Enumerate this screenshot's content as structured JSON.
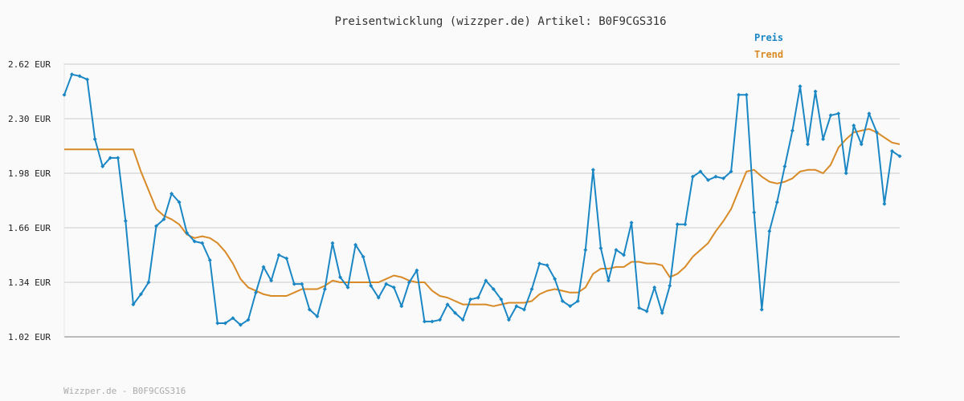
{
  "colors": {
    "price": "#1a87c4",
    "trend": "#d88a26",
    "grid": "#e2e2e2",
    "axis": "#bbbbbb"
  },
  "chart_data": {
    "type": "line",
    "title": "Preisentwicklung (wizzper.de) Artikel: B0F9CGS316",
    "legend": [
      "Preis",
      "Trend"
    ],
    "legend_position": "top-right",
    "grid": true,
    "ylim": [
      1.02,
      2.62
    ],
    "y_ticks": [
      "2.62 EUR",
      "2.30 EUR",
      "1.98 EUR",
      "1.66 EUR",
      "1.34 EUR",
      "1.02 EUR"
    ],
    "series": [
      {
        "name": "Preis",
        "values": [
          2.44,
          2.56,
          2.55,
          2.53,
          2.18,
          2.02,
          2.07,
          2.07,
          1.7,
          1.21,
          1.27,
          1.34,
          1.67,
          1.71,
          1.86,
          1.81,
          1.63,
          1.58,
          1.57,
          1.47,
          1.1,
          1.1,
          1.13,
          1.09,
          1.12,
          1.28,
          1.43,
          1.35,
          1.5,
          1.48,
          1.33,
          1.33,
          1.18,
          1.14,
          1.3,
          1.57,
          1.37,
          1.31,
          1.56,
          1.49,
          1.32,
          1.25,
          1.33,
          1.31,
          1.2,
          1.34,
          1.41,
          1.11,
          1.11,
          1.12,
          1.21,
          1.16,
          1.12,
          1.24,
          1.25,
          1.35,
          1.3,
          1.24,
          1.12,
          1.2,
          1.18,
          1.3,
          1.45,
          1.44,
          1.36,
          1.23,
          1.2,
          1.23,
          1.53,
          2.0,
          1.54,
          1.35,
          1.53,
          1.5,
          1.69,
          1.19,
          1.17,
          1.31,
          1.16,
          1.32,
          1.68,
          1.68,
          1.96,
          1.99,
          1.94,
          1.96,
          1.95,
          1.99,
          2.44,
          2.44,
          1.75,
          1.18,
          1.64,
          1.81,
          2.02,
          2.23,
          2.49,
          2.15,
          2.46,
          2.18,
          2.32,
          2.33,
          1.98,
          2.26,
          2.15,
          2.33,
          2.22,
          1.8,
          2.11,
          2.08
        ]
      },
      {
        "name": "Trend",
        "values": [
          2.12,
          2.12,
          2.12,
          2.12,
          2.12,
          2.12,
          2.12,
          2.12,
          2.12,
          2.12,
          1.99,
          1.88,
          1.77,
          1.73,
          1.71,
          1.68,
          1.62,
          1.6,
          1.61,
          1.6,
          1.57,
          1.52,
          1.45,
          1.36,
          1.31,
          1.29,
          1.27,
          1.26,
          1.26,
          1.26,
          1.28,
          1.3,
          1.3,
          1.3,
          1.32,
          1.35,
          1.34,
          1.34,
          1.34,
          1.34,
          1.34,
          1.34,
          1.36,
          1.38,
          1.37,
          1.35,
          1.34,
          1.34,
          1.29,
          1.26,
          1.25,
          1.23,
          1.21,
          1.21,
          1.21,
          1.21,
          1.2,
          1.21,
          1.22,
          1.22,
          1.22,
          1.23,
          1.27,
          1.29,
          1.3,
          1.29,
          1.28,
          1.28,
          1.31,
          1.39,
          1.42,
          1.42,
          1.43,
          1.43,
          1.46,
          1.46,
          1.45,
          1.45,
          1.44,
          1.37,
          1.39,
          1.43,
          1.49,
          1.53,
          1.57,
          1.64,
          1.7,
          1.77,
          1.88,
          1.99,
          2.0,
          1.96,
          1.93,
          1.92,
          1.93,
          1.95,
          1.99,
          2.0,
          2.0,
          1.98,
          2.03,
          2.13,
          2.18,
          2.22,
          2.23,
          2.24,
          2.22,
          2.19,
          2.16,
          2.15
        ]
      }
    ]
  },
  "footer": "Wizzper.de - B0F9CGS316"
}
